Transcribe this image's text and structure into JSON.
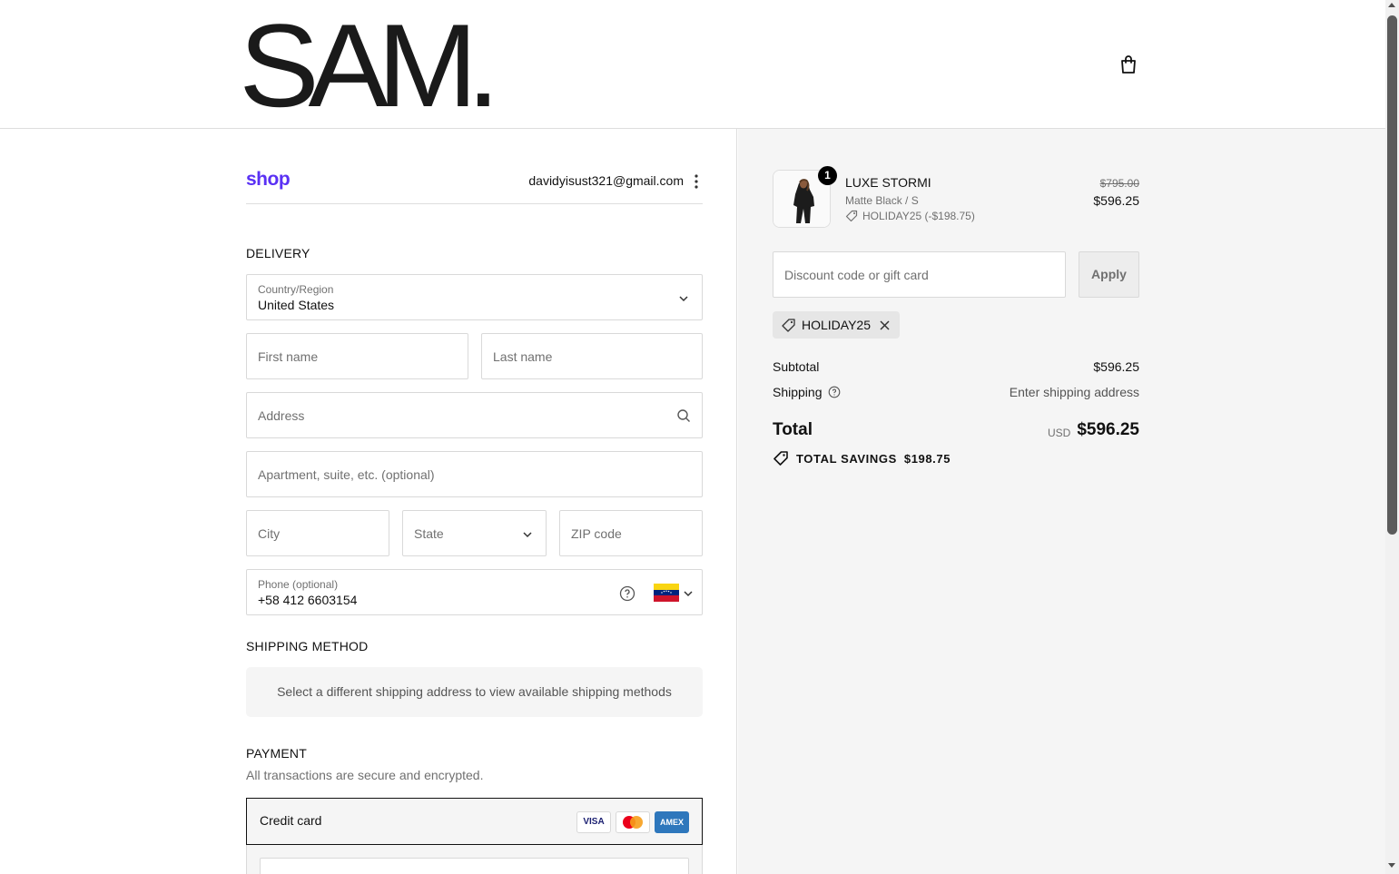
{
  "brand": {
    "logo_text": "SAM."
  },
  "header": {
    "cart_icon": "shopping-bag-icon"
  },
  "account": {
    "shop_label": "shop",
    "email": "davidyisust321@gmail.com"
  },
  "delivery": {
    "title": "DELIVERY",
    "country": {
      "label": "Country/Region",
      "value": "United States"
    },
    "first_name": {
      "placeholder": "First name"
    },
    "last_name": {
      "placeholder": "Last name"
    },
    "address": {
      "placeholder": "Address"
    },
    "apartment": {
      "placeholder": "Apartment, suite, etc. (optional)"
    },
    "city": {
      "placeholder": "City"
    },
    "state": {
      "placeholder": "State"
    },
    "zip": {
      "placeholder": "ZIP code"
    },
    "phone": {
      "label": "Phone (optional)",
      "value": "+58 412 6603154",
      "flag": "venezuela-flag-icon"
    }
  },
  "shipping_method": {
    "title": "SHIPPING METHOD",
    "message": "Select a different shipping address to view available shipping methods"
  },
  "payment": {
    "title": "PAYMENT",
    "subtitle": "All transactions are secure and encrypted.",
    "method_label": "Credit card",
    "cards": [
      "VISA",
      "MC",
      "AMEX"
    ]
  },
  "order": {
    "item": {
      "quantity": "1",
      "name": "LUXE STORMI",
      "variant": "Matte Black / S",
      "discount": "HOLIDAY25 (-$198.75)",
      "price_original": "$795.00",
      "price_final": "$596.25"
    },
    "discount_input": {
      "placeholder": "Discount code or gift card"
    },
    "apply_label": "Apply",
    "applied_code": "HOLIDAY25",
    "subtotal_label": "Subtotal",
    "subtotal_value": "$596.25",
    "shipping_label": "Shipping",
    "shipping_value": "Enter shipping address",
    "total_label": "Total",
    "total_currency": "USD",
    "total_value": "$596.25",
    "savings_label": "TOTAL SAVINGS",
    "savings_value": "$198.75"
  },
  "colors": {
    "shop_purple": "#5a31f4",
    "summary_bg": "#f5f5f5",
    "amex_blue": "#2e77bc",
    "mastercard_red": "#eb001b",
    "mastercard_orange": "#f79e1b"
  }
}
